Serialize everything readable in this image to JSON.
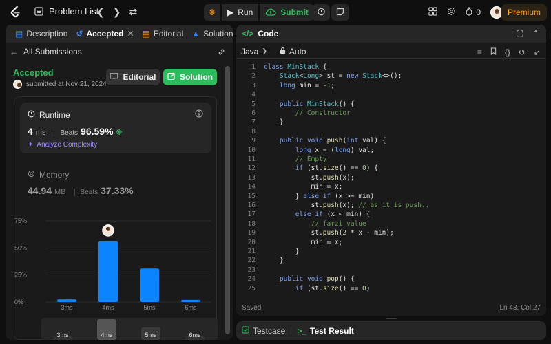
{
  "topbar": {
    "problem_list": "Problem List",
    "run": "Run",
    "submit": "Submit",
    "streak": "0",
    "premium": "Premium"
  },
  "left": {
    "tabs": [
      {
        "label": "Description"
      },
      {
        "label": "Accepted"
      },
      {
        "label": "Editorial"
      },
      {
        "label": "Solutions"
      }
    ],
    "all_submissions": "All Submissions",
    "status": "Accepted",
    "submitted": "submitted at Nov 21, 2024",
    "editorial_btn": "Editorial",
    "solution_btn": "Solution",
    "runtime": {
      "title": "Runtime",
      "value": "4",
      "unit": "ms",
      "beats_label": "Beats",
      "beats": "96.59%",
      "analyze": "Analyze Complexity"
    },
    "memory": {
      "title": "Memory",
      "value": "44.94",
      "unit": "MB",
      "beats_label": "Beats",
      "beats": "37.33%"
    }
  },
  "chart_data": {
    "type": "bar",
    "categories": [
      "3ms",
      "4ms",
      "5ms",
      "6ms"
    ],
    "values": [
      2.5,
      56,
      31,
      2
    ],
    "highlight": "4ms",
    "y_ticks": [
      "0%",
      "25%",
      "50%",
      "75%"
    ],
    "ylim": [
      0,
      75
    ],
    "slider_labels": [
      "3ms",
      "4ms",
      "5ms",
      "6ms"
    ],
    "bar_color": "#0a84ff"
  },
  "right": {
    "title": "Code",
    "language": "Java",
    "mode": "Auto",
    "saved": "Saved",
    "cursor": "Ln 43, Col 27",
    "bottom_tabs": [
      {
        "label": "Testcase"
      },
      {
        "label": "Test Result"
      }
    ]
  },
  "code_lines": [
    {
      "n": "1",
      "t": "class MinStack {"
    },
    {
      "n": "2",
      "t": "    Stack<Long> st = new Stack<>();"
    },
    {
      "n": "3",
      "t": "    long min = -1;"
    },
    {
      "n": "4",
      "t": ""
    },
    {
      "n": "5",
      "t": "    public MinStack() {"
    },
    {
      "n": "6",
      "t": "        // Constructor"
    },
    {
      "n": "7",
      "t": "    }"
    },
    {
      "n": "8",
      "t": ""
    },
    {
      "n": "9",
      "t": "    public void push(int val) {"
    },
    {
      "n": "10",
      "t": "        long x = (long) val;"
    },
    {
      "n": "11",
      "t": "        // Empty"
    },
    {
      "n": "12",
      "t": "        if (st.size() == 0) {"
    },
    {
      "n": "13",
      "t": "            st.push(x);"
    },
    {
      "n": "14",
      "t": "            min = x;"
    },
    {
      "n": "15",
      "t": "        } else if (x >= min)"
    },
    {
      "n": "16",
      "t": "            st.push(x); // as it is push.."
    },
    {
      "n": "17",
      "t": "        else if (x < min) {"
    },
    {
      "n": "18",
      "t": "            // farzi value"
    },
    {
      "n": "19",
      "t": "            st.push(2 * x - min);"
    },
    {
      "n": "20",
      "t": "            min = x;"
    },
    {
      "n": "21",
      "t": "        }"
    },
    {
      "n": "22",
      "t": "    }"
    },
    {
      "n": "23",
      "t": ""
    },
    {
      "n": "24",
      "t": "    public void pop() {"
    },
    {
      "n": "25",
      "t": "        if (st.size() == 0)"
    }
  ]
}
